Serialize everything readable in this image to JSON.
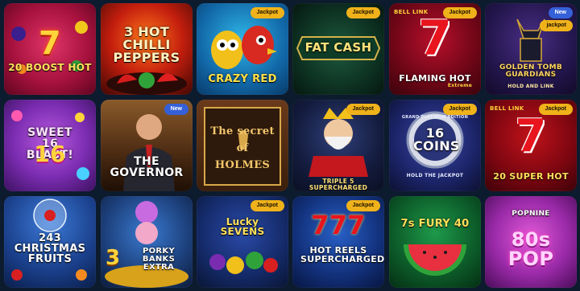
{
  "badges": {
    "jackpot": "Jackpot",
    "new": "New",
    "jackpot_lower": "jackpot"
  },
  "games": [
    {
      "title": "20 BOOST HOT",
      "big": "7"
    },
    {
      "title": "3 HOT CHILLI PEPPERS"
    },
    {
      "title": "CRAZY RED",
      "badge": "Jackpot"
    },
    {
      "title": "FAT CASH",
      "badge": "Jackpot"
    },
    {
      "title": "FLAMING HOT",
      "sub": "Extreme",
      "big": "7",
      "badge": "Jackpot",
      "logo": "BELL LINK"
    },
    {
      "title": "GOLDEN TOMB GUARDIANS",
      "sub": "HOLD AND LINK",
      "badge": "New",
      "badge2": "jackpot"
    },
    {
      "title": "SWEET 16 BLAST!",
      "big": "16"
    },
    {
      "title": "THE GOVERNOR",
      "badge": "New"
    },
    {
      "title": "The secret of HOLMES"
    },
    {
      "title": "TRIPLE 5 SUPERCHARGED",
      "badge": "Jackpot"
    },
    {
      "title": "16 COINS",
      "sub": "HOLD THE JACKPOT",
      "badge": "Jackpot",
      "tagline": "GRAND PLATINUM EDITION"
    },
    {
      "title": "20 SUPER HOT",
      "big": "7",
      "badge": "Jackpot",
      "logo": "BELL LINK"
    },
    {
      "title": "243 CHRISTMAS FRUITS"
    },
    {
      "title": "PORKY BANKS EXTRA",
      "big": "3"
    },
    {
      "title": "Lucky SEVENS",
      "badge": "Jackpot"
    },
    {
      "title": "HOT REELS SUPERCHARGED",
      "badge": "Jackpot",
      "big": "777"
    },
    {
      "title": "7s FURY 40"
    },
    {
      "title": "80s POP",
      "sub": "POPNINE"
    }
  ]
}
